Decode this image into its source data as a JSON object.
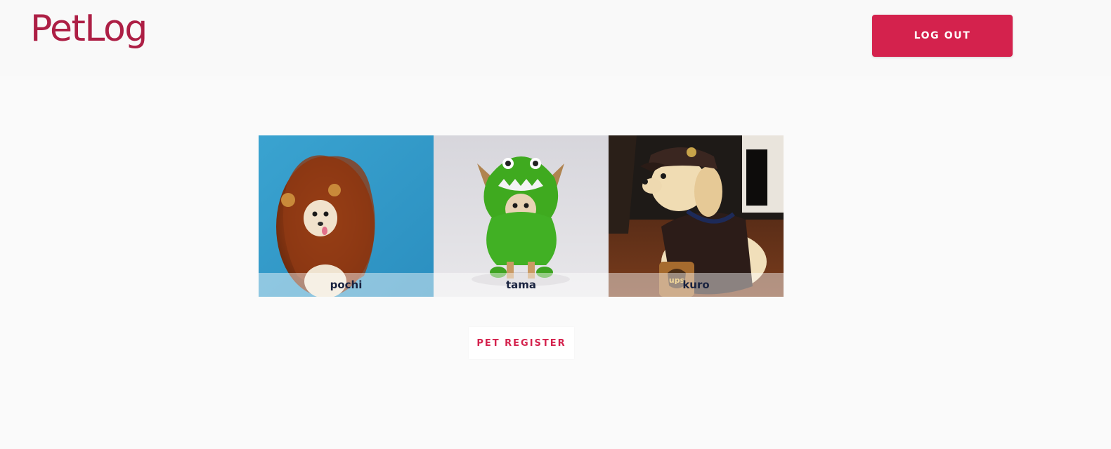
{
  "header": {
    "logo": "PetLog",
    "logout_label": "LOG OUT"
  },
  "pets": [
    {
      "name": "pochi"
    },
    {
      "name": "tama"
    },
    {
      "name": "kuro"
    }
  ],
  "actions": {
    "register_label": "PET REGISTER"
  },
  "colors": {
    "brand": "#ad1f45",
    "accent": "#d4224d",
    "background": "#fafafa"
  }
}
